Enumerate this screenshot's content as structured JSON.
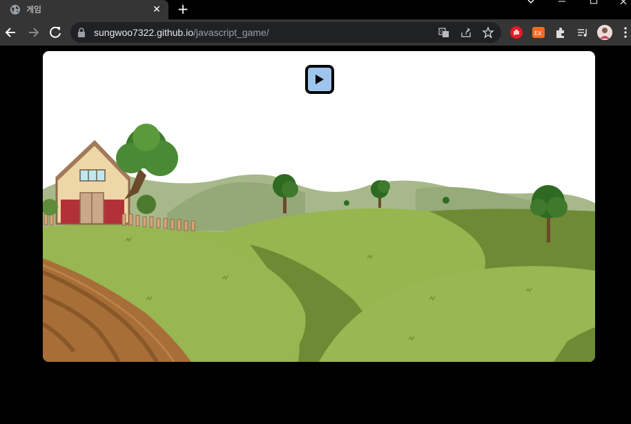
{
  "tab": {
    "title": "게임",
    "close_label": "✕"
  },
  "new_tab_label": "+",
  "address_bar": {
    "domain": "sungwoo7322.github.io",
    "path": "/javascript_game/"
  },
  "game": {
    "play_button": "play-icon",
    "colors": {
      "sky": "#ffffff",
      "grass": "#97b64f",
      "dark_grass": "#6f8a34",
      "hills": "#a8b98a",
      "soil": "#a56a34",
      "barn": "#b23139"
    }
  }
}
